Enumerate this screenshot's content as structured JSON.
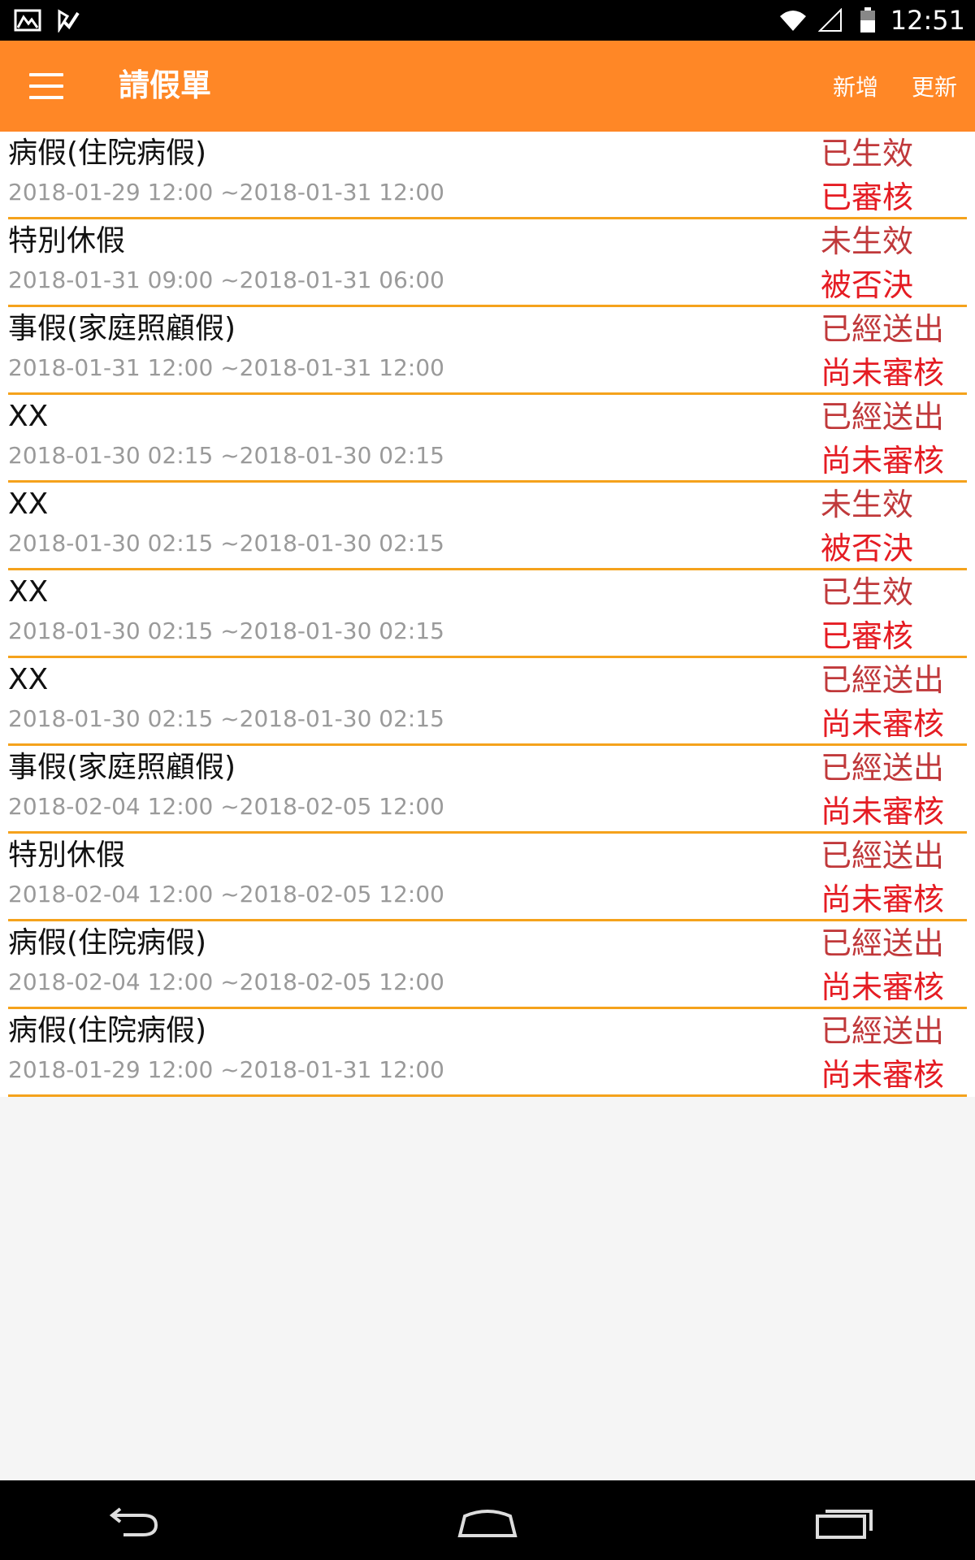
{
  "status_bar": {
    "time": "12:51",
    "icons": [
      "gallery-icon",
      "checkmark-notification-icon",
      "wifi-icon",
      "signal-icon",
      "battery-icon"
    ]
  },
  "toolbar": {
    "title": "請假單",
    "add_label": "新增",
    "refresh_label": "更新",
    "color": "#ff8726"
  },
  "leave_requests": [
    {
      "type": "病假(住院病假)",
      "period": "2018-01-29 12:00 ~2018-01-31 12:00",
      "effect_status": "已生效",
      "review_status": "已審核"
    },
    {
      "type": "特別休假",
      "period": "2018-01-31 09:00 ~2018-01-31 06:00",
      "effect_status": "未生效",
      "review_status": "被否決"
    },
    {
      "type": "事假(家庭照顧假)",
      "period": "2018-01-31 12:00 ~2018-01-31 12:00",
      "effect_status": "已經送出",
      "review_status": "尚未審核"
    },
    {
      "type": "XX",
      "period": "2018-01-30 02:15 ~2018-01-30 02:15",
      "effect_status": "已經送出",
      "review_status": "尚未審核"
    },
    {
      "type": "XX",
      "period": "2018-01-30 02:15 ~2018-01-30 02:15",
      "effect_status": "未生效",
      "review_status": "被否決"
    },
    {
      "type": "XX",
      "period": "2018-01-30 02:15 ~2018-01-30 02:15",
      "effect_status": "已生效",
      "review_status": "已審核"
    },
    {
      "type": "XX",
      "period": "2018-01-30 02:15 ~2018-01-30 02:15",
      "effect_status": "已經送出",
      "review_status": "尚未審核"
    },
    {
      "type": "事假(家庭照顧假)",
      "period": "2018-02-04 12:00 ~2018-02-05 12:00",
      "effect_status": "已經送出",
      "review_status": "尚未審核"
    },
    {
      "type": "特別休假",
      "period": "2018-02-04 12:00 ~2018-02-05 12:00",
      "effect_status": "已經送出",
      "review_status": "尚未審核"
    },
    {
      "type": "病假(住院病假)",
      "period": "2018-02-04 12:00 ~2018-02-05 12:00",
      "effect_status": "已經送出",
      "review_status": "尚未審核"
    },
    {
      "type": "病假(住院病假)",
      "period": "2018-01-29 12:00 ~2018-01-31 12:00",
      "effect_status": "已經送出",
      "review_status": "尚未審核"
    }
  ],
  "nav_bar": {
    "icons": [
      "back-icon",
      "home-icon",
      "recent-apps-icon"
    ]
  }
}
